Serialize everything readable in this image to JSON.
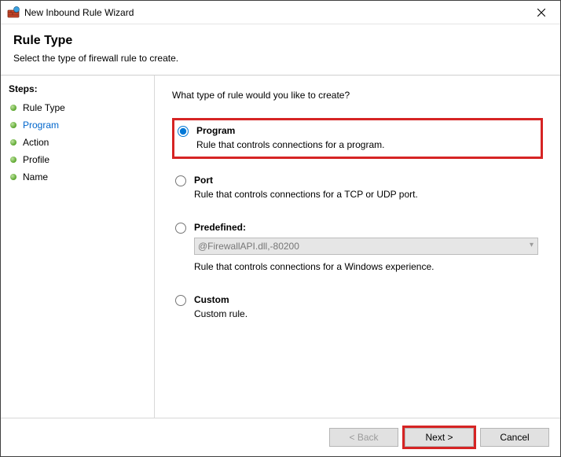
{
  "window": {
    "title": "New Inbound Rule Wizard"
  },
  "header": {
    "title": "Rule Type",
    "subtitle": "Select the type of firewall rule to create."
  },
  "sidebar": {
    "title": "Steps:",
    "items": [
      {
        "label": "Rule Type",
        "current": false
      },
      {
        "label": "Program",
        "current": true
      },
      {
        "label": "Action",
        "current": false
      },
      {
        "label": "Profile",
        "current": false
      },
      {
        "label": "Name",
        "current": false
      }
    ]
  },
  "main": {
    "prompt": "What type of rule would you like to create?",
    "options": {
      "program": {
        "title": "Program",
        "desc": "Rule that controls connections for a program.",
        "selected": true
      },
      "port": {
        "title": "Port",
        "desc": "Rule that controls connections for a TCP or UDP port.",
        "selected": false
      },
      "predefined": {
        "title": "Predefined:",
        "select_value": "@FirewallAPI.dll,-80200",
        "desc": "Rule that controls connections for a Windows experience.",
        "selected": false
      },
      "custom": {
        "title": "Custom",
        "desc": "Custom rule.",
        "selected": false
      }
    }
  },
  "footer": {
    "back": "< Back",
    "next": "Next >",
    "cancel": "Cancel"
  }
}
